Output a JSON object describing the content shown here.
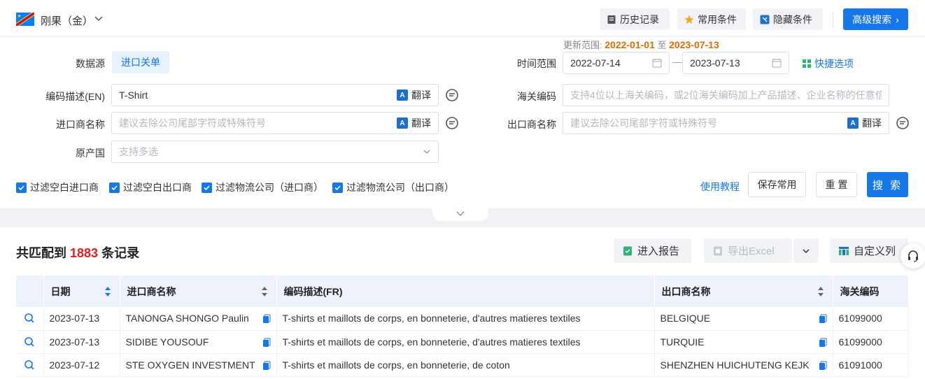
{
  "header": {
    "country": "刚果（金）",
    "buttons": {
      "history": "历史记录",
      "favorites": "常用条件",
      "hide": "隐藏条件",
      "advanced": "高级搜索"
    }
  },
  "form": {
    "update_range_label": "更新范围:",
    "update_start": "2022-01-01",
    "update_to": "至",
    "update_end": "2023-07-13",
    "datasource_label": "数据源",
    "datasource_value": "进口关单",
    "time_range_label": "时间范围",
    "date_from": "2022-07-14",
    "date_sep": "—",
    "date_to": "2023-07-13",
    "quick_options": "快捷选项",
    "code_desc_label": "编码描述(EN)",
    "code_desc_value": "T-Shirt",
    "translate": "翻译",
    "hs_code_label": "海关编码",
    "hs_code_placeholder": "支持4位以上海关编码，或2位海关编码加上产品描述、企业名称的任意信息",
    "importer_label": "进口商名称",
    "importer_placeholder": "建议去除公司尾部字符或特殊符号",
    "exporter_label": "出口商名称",
    "exporter_placeholder": "建议去除公司尾部字符或特殊符号",
    "origin_label": "原产国",
    "origin_placeholder": "支持多选",
    "filters": [
      "过滤空白进口商",
      "过滤空白出口商",
      "过滤物流公司（进口商）",
      "过滤物流公司（出口商）"
    ],
    "tutorial": "使用教程",
    "save_common": "保存常用",
    "reset": "重 置",
    "search": "搜 索"
  },
  "results": {
    "prefix": "共匹配到",
    "count": "1883",
    "suffix": "条记录",
    "report": "进入报告",
    "export": "导出Excel",
    "custom_cols": "自定义列",
    "columns": [
      "日期",
      "进口商名称",
      "编码描述(FR)",
      "出口商名称",
      "海关编码"
    ],
    "rows": [
      {
        "date": "2023-07-13",
        "importer": "TANONGA SHONGO Paulin",
        "desc": "T-shirts et maillots de corps, en bonneterie, d'autres matieres textiles",
        "exporter": "BELGIQUE",
        "code": "61099000"
      },
      {
        "date": "2023-07-13",
        "importer": "SIDIBE YOUSOUF",
        "desc": "T-shirts et maillots de corps, en bonneterie, d'autres matieres textiles",
        "exporter": "TURQUIE",
        "code": "61099000"
      },
      {
        "date": "2023-07-12",
        "importer": "STE OXYGEN INVESTMENT",
        "desc": "T-shirts et maillots de corps, en bonneterie, de coton",
        "exporter": "SHENZHEN HUICHUTENG KEJK",
        "code": "61091000"
      }
    ]
  },
  "colors": {
    "primary": "#1677e8",
    "count_red": "#e02020",
    "update_orange": "#e06c00"
  }
}
